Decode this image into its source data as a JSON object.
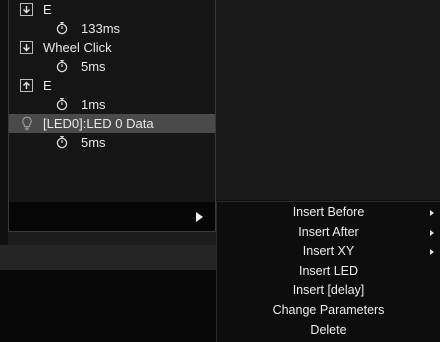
{
  "macro": {
    "events": [
      {
        "icon": "key-down-icon",
        "label": "E"
      },
      {
        "icon": "timer-icon",
        "label": "133ms"
      },
      {
        "icon": "key-down-icon",
        "label": "Wheel Click"
      },
      {
        "icon": "timer-icon",
        "label": "5ms"
      },
      {
        "icon": "key-up-icon",
        "label": "E"
      },
      {
        "icon": "timer-icon",
        "label": "1ms"
      },
      {
        "icon": "bulb-icon",
        "label": "[LED0]:LED 0 Data",
        "selected": true
      },
      {
        "icon": "timer-icon",
        "label": "5ms"
      }
    ],
    "play_icon": "play-icon"
  },
  "context_menu": {
    "items": [
      {
        "label": "Insert Before",
        "submenu": true
      },
      {
        "label": "Insert After",
        "submenu": true
      },
      {
        "label": "Insert XY",
        "submenu": true
      },
      {
        "label": "Insert LED",
        "submenu": false
      },
      {
        "label": "Insert [delay]",
        "submenu": false
      },
      {
        "label": "Change Parameters",
        "submenu": false
      },
      {
        "label": "Delete",
        "submenu": false
      }
    ]
  },
  "colors": {
    "selected_row": "#4a4a4a",
    "menu_bg": "#0d0d0d",
    "text": "#e8e8e8"
  }
}
